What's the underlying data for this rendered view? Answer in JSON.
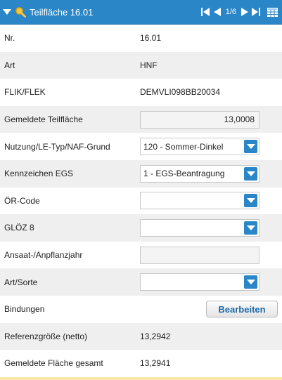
{
  "header": {
    "title": "Teilfläche 16.01",
    "pager": "1/6",
    "accent": "#2a86c7"
  },
  "rows": {
    "nr": {
      "label": "Nr.",
      "value": "16.01"
    },
    "art": {
      "label": "Art",
      "value": "HNF"
    },
    "flik": {
      "label": "FLIK/FLEK",
      "value": "DEMVLI098BB20034"
    },
    "gemeldete_teilflaeche": {
      "label": "Gemeldete Teilfläche",
      "value": "13,0008"
    },
    "nutzung": {
      "label": "Nutzung/LE-Typ/NAF-Grund",
      "value": "120 - Sommer-Dinkel"
    },
    "egs": {
      "label": "Kennzeichen EGS",
      "value": "1 - EGS-Beantragung"
    },
    "oer_code": {
      "label": "ÖR-Code",
      "value": ""
    },
    "gloez": {
      "label": "GLÖZ 8",
      "value": ""
    },
    "ansaat": {
      "label": "Ansaat-/Anpflanzjahr",
      "value": ""
    },
    "art_sorte": {
      "label": "Art/Sorte",
      "value": ""
    },
    "bindungen": {
      "label": "Bindungen",
      "button": "Bearbeiten"
    },
    "referenz": {
      "label": "Referenzgröße (netto)",
      "value": "13,2942"
    },
    "gesamt": {
      "label": "Gemeldete Fläche gesamt",
      "value": "13,2941"
    }
  },
  "icons": {
    "collapse": "triangle-down-icon",
    "search": "magnifier-icon",
    "first": "first-page-icon",
    "prev": "prev-page-icon",
    "next": "next-page-icon",
    "last": "last-page-icon",
    "grid": "grid-icon"
  }
}
